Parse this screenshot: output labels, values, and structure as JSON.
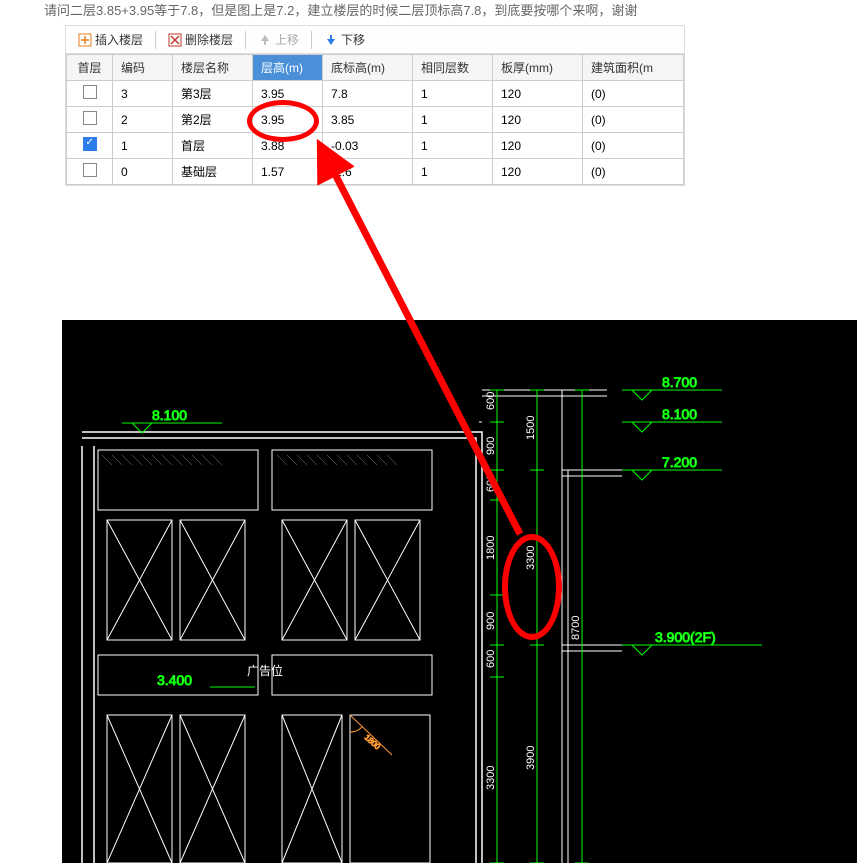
{
  "description": "请问二层3.85+3.95等于7.8，但是图上是7.2，建立楼层的时候二层顶标高7.8，到底要按哪个来啊，谢谢",
  "toolbar": {
    "insert_floor": "插入楼层",
    "delete_floor": "删除楼层",
    "move_up": "上移",
    "move_down": "下移"
  },
  "table": {
    "headers": {
      "first_floor": "首层",
      "code": "编码",
      "floor_name": "楼层名称",
      "floor_height": "层高(m)",
      "bottom_elevation": "底标高(m)",
      "same_floors": "相同层数",
      "slab_thickness": "板厚(mm)",
      "building_area": "建筑面积(m"
    },
    "rows": [
      {
        "checked": false,
        "code": "3",
        "name": "第3层",
        "height": "3.95",
        "bottom": "7.8",
        "same": "1",
        "thickness": "120",
        "area": "(0)"
      },
      {
        "checked": false,
        "code": "2",
        "name": "第2层",
        "height": "3.95",
        "bottom": "3.85",
        "same": "1",
        "thickness": "120",
        "area": "(0)"
      },
      {
        "checked": true,
        "code": "1",
        "name": "首层",
        "height": "3.88",
        "bottom": "-0.03",
        "same": "1",
        "thickness": "120",
        "area": "(0)"
      },
      {
        "checked": false,
        "code": "0",
        "name": "基础层",
        "height": "1.57",
        "bottom": "-1.6",
        "same": "1",
        "thickness": "120",
        "area": "(0)"
      }
    ]
  },
  "cad": {
    "elevations": {
      "e1": "8.700",
      "e2": "8.100",
      "e3": "7.200",
      "e4": "3.900(2F)",
      "left1": "8.100",
      "left2": "3.400"
    },
    "dims": {
      "d600a": "600",
      "d600b": "600",
      "d900a": "900",
      "d1500": "1500",
      "d1800": "1800",
      "d3300a": "3300",
      "d8700": "8700",
      "d900b": "900",
      "d600c": "600",
      "d3300b": "3300",
      "d3900": "3900"
    },
    "label_ad": "广告位",
    "label_angle": "1800"
  }
}
